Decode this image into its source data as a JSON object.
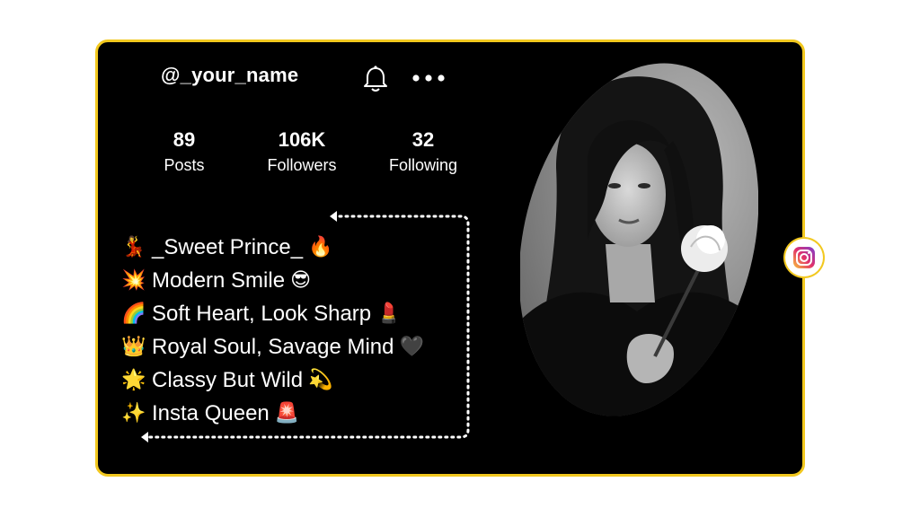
{
  "profile": {
    "username": "@_your_name"
  },
  "icons": {
    "notification": "bell-icon",
    "more": "more-options-icon",
    "platform": "instagram-icon"
  },
  "stats": [
    {
      "value": "89",
      "label": "Posts"
    },
    {
      "value": "106K",
      "label": "Followers"
    },
    {
      "value": "32",
      "label": "Following"
    }
  ],
  "bio": [
    {
      "lead": "💃",
      "text": "_Sweet Prince_",
      "trail": "🔥"
    },
    {
      "lead": "💥",
      "text": "Modern Smile",
      "trail": "😎"
    },
    {
      "lead": "🌈",
      "text": "Soft Heart, Look Sharp",
      "trail": "💄"
    },
    {
      "lead": "👑",
      "text": "Royal Soul, Savage Mind",
      "trail": "🖤"
    },
    {
      "lead": "🌟",
      "text": "Classy But Wild",
      "trail": "💫"
    },
    {
      "lead": "✨",
      "text": "Insta Queen",
      "trail": "🚨"
    }
  ],
  "colors": {
    "card_background": "#000000",
    "card_border": "#f2c81f",
    "text": "#ffffff",
    "page_background": "#ffffff"
  }
}
